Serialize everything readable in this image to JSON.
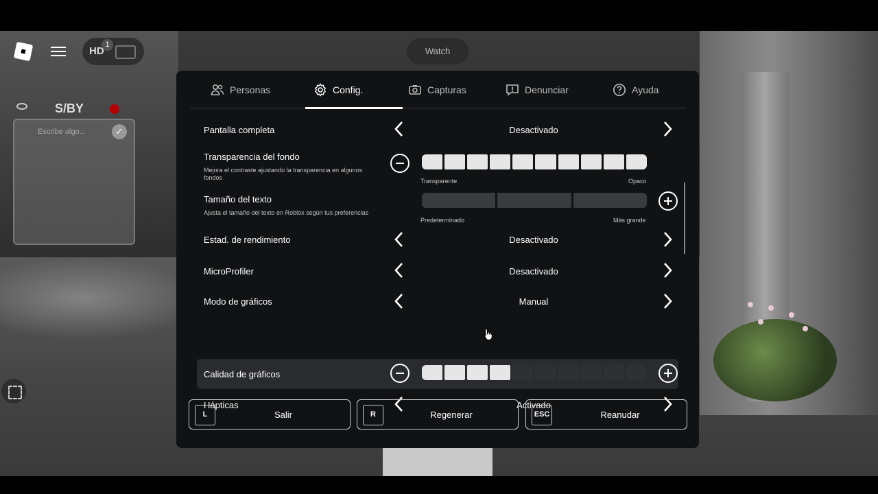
{
  "hud": {
    "hd_label": "HD",
    "badge_count": "1",
    "watch_label": "Watch",
    "player_tag": "S/BY",
    "chat_placeholder": "Escribe algo..."
  },
  "tabs": [
    {
      "label": "Personas",
      "icon": "people-icon",
      "active": false
    },
    {
      "label": "Config.",
      "icon": "gear-icon",
      "active": true
    },
    {
      "label": "Capturas",
      "icon": "camera-icon",
      "active": false
    },
    {
      "label": "Denunciar",
      "icon": "report-icon",
      "active": false
    },
    {
      "label": "Ayuda",
      "icon": "help-icon",
      "active": false
    }
  ],
  "settings": {
    "fullscreen": {
      "label": "Pantalla completa",
      "value": "Desactivado"
    },
    "bg_transparency": {
      "label": "Transparencia del fondo",
      "description": "Mejora el contraste ajustando la transparencia en algunos fondos",
      "level": 10,
      "max": 10,
      "min_label": "Transparente",
      "max_label": "Opaco"
    },
    "text_size": {
      "label": "Tamaño del texto",
      "description": "Ajusta el tamaño del texto en Roblox según tus preferencias",
      "level": 0,
      "max": 3,
      "min_label": "Predeterminado",
      "max_label": "Más grande"
    },
    "perf_stats": {
      "label": "Estad. de rendimiento",
      "value": "Desactivado"
    },
    "microprofiler": {
      "label": "MicroProfiler",
      "value": "Desactivado"
    },
    "graphics_mode": {
      "label": "Modo de gráficos",
      "value": "Manual"
    },
    "graphics_quality": {
      "label": "Calidad de gráficos",
      "level": 4,
      "max": 10
    },
    "haptics": {
      "label": "Hápticas",
      "value": "Activado"
    }
  },
  "footer": {
    "leave": {
      "key": "L",
      "label": "Salir"
    },
    "reset": {
      "key": "R",
      "label": "Regenerar"
    },
    "resume": {
      "key": "ESC",
      "label": "Reanudar"
    }
  }
}
